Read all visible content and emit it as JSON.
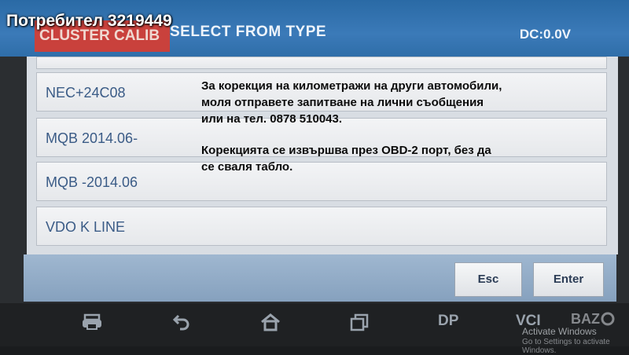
{
  "header": {
    "tab_label": "CLUSTER CALIB",
    "title": "SELECT FROM TYPE",
    "voltage": "DC:0.0V"
  },
  "watermark_user": "Потребител 3219449",
  "list": {
    "items": [
      {
        "label": "NEC+24C08"
      },
      {
        "label": "MQB 2014.06-"
      },
      {
        "label": "MQB -2014.06"
      },
      {
        "label": "VDO K LINE"
      }
    ]
  },
  "buttons": {
    "esc": "Esc",
    "enter": "Enter"
  },
  "navbar": {
    "dp_label": "DP",
    "vci_label": "VCI"
  },
  "overlay": {
    "line1": "За корекция на километражи на други автомобили,",
    "line2": "моля отправете запитване на лични съобщения",
    "line3": "или на тел. 0878 510043.",
    "line4": "Корекцията се извършва през OBD-2 порт, без да",
    "line5": "се сваля табло."
  },
  "windows_activate": {
    "line1": "Activate Windows",
    "line2": "Go to Settings to activate Windows."
  },
  "logo_text": "BAZAR",
  "colors": {
    "topbar": "#3b7ab8",
    "tab_red": "#c9413c",
    "row_text": "#3a5b86",
    "bottom_panel": "#9fb7d0"
  }
}
